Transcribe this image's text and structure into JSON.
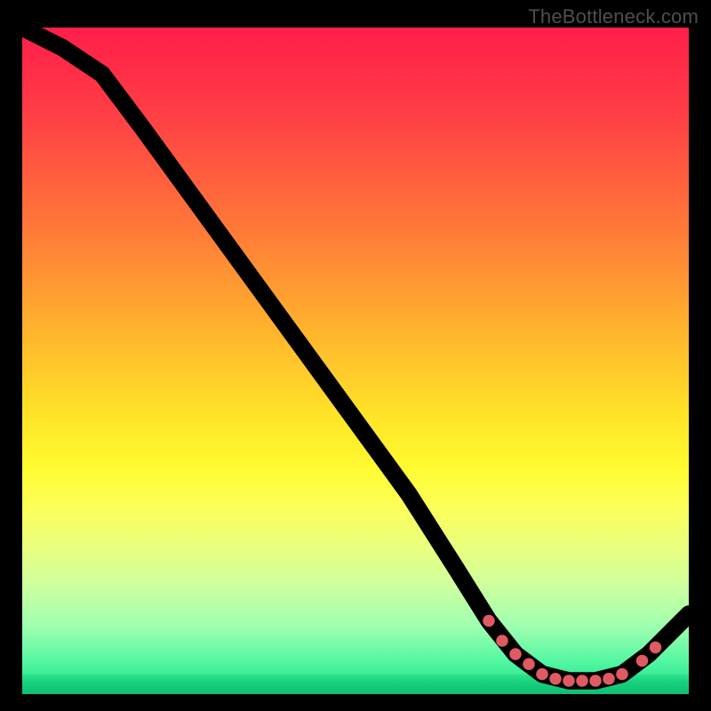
{
  "attribution": "TheBottleneck.com",
  "chart_data": {
    "type": "line",
    "title": "",
    "xlabel": "",
    "ylabel": "",
    "xlim": [
      0,
      100
    ],
    "ylim": [
      0,
      100
    ],
    "curve": [
      {
        "x": 0,
        "y": 100
      },
      {
        "x": 6,
        "y": 97
      },
      {
        "x": 12,
        "y": 93
      },
      {
        "x": 18,
        "y": 85
      },
      {
        "x": 26,
        "y": 74
      },
      {
        "x": 34,
        "y": 63
      },
      {
        "x": 42,
        "y": 52
      },
      {
        "x": 50,
        "y": 41
      },
      {
        "x": 58,
        "y": 30
      },
      {
        "x": 65,
        "y": 19
      },
      {
        "x": 70,
        "y": 11
      },
      {
        "x": 74,
        "y": 6
      },
      {
        "x": 78,
        "y": 3
      },
      {
        "x": 82,
        "y": 2
      },
      {
        "x": 86,
        "y": 2
      },
      {
        "x": 90,
        "y": 3
      },
      {
        "x": 94,
        "y": 6
      },
      {
        "x": 100,
        "y": 12
      }
    ],
    "markers": [
      {
        "x": 70,
        "y": 11
      },
      {
        "x": 72,
        "y": 8
      },
      {
        "x": 74,
        "y": 6
      },
      {
        "x": 76,
        "y": 4.5
      },
      {
        "x": 78,
        "y": 3
      },
      {
        "x": 80,
        "y": 2.3
      },
      {
        "x": 82,
        "y": 2
      },
      {
        "x": 84,
        "y": 2
      },
      {
        "x": 86,
        "y": 2
      },
      {
        "x": 88,
        "y": 2.3
      },
      {
        "x": 90,
        "y": 3
      },
      {
        "x": 93,
        "y": 5
      },
      {
        "x": 95,
        "y": 7
      }
    ],
    "gradient_stops": [
      {
        "pos": 0,
        "color": "#ff1e4a"
      },
      {
        "pos": 30,
        "color": "#ff7838"
      },
      {
        "pos": 58,
        "color": "#ffe328"
      },
      {
        "pos": 78,
        "color": "#eaff7f"
      },
      {
        "pos": 100,
        "color": "#18dd86"
      }
    ]
  }
}
